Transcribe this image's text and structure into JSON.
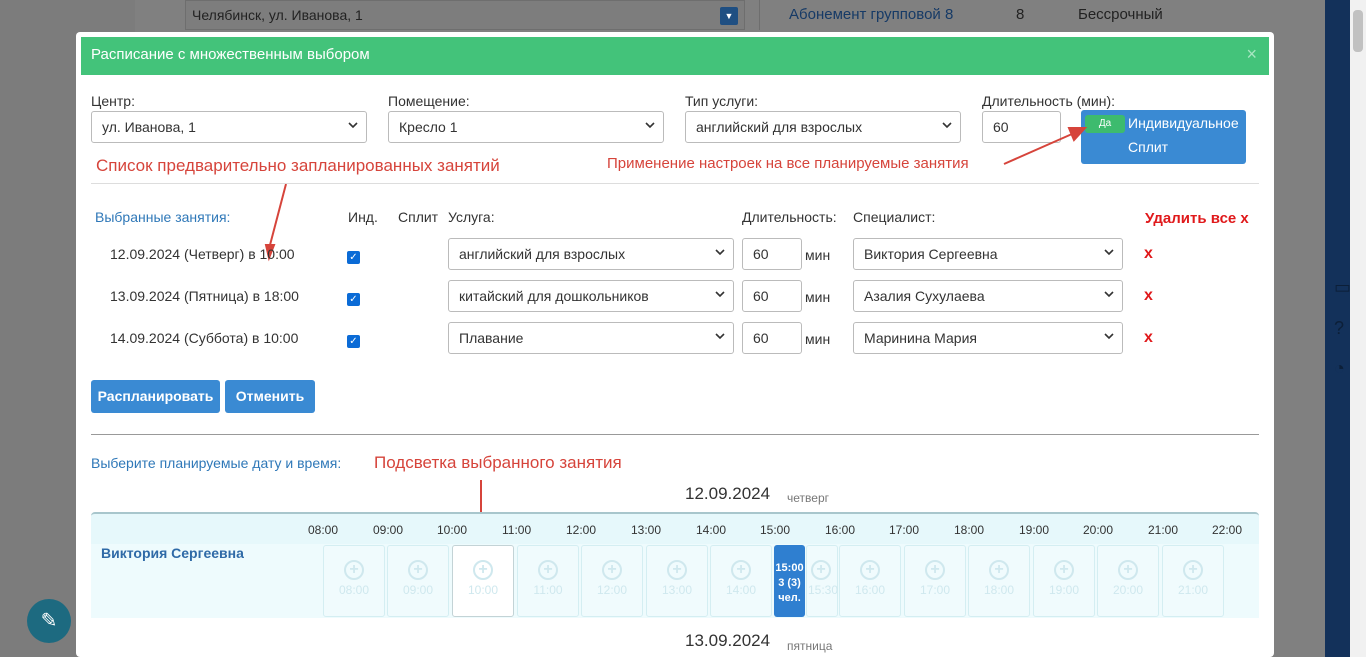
{
  "background": {
    "city_field": "Челябинск, ул. Иванова, 1",
    "subscription_link": "Абонемент групповой 8",
    "subscription_count": "8",
    "subscription_term": "Бессрочный"
  },
  "modal": {
    "title": "Расписание с множественным выбором",
    "close": "×"
  },
  "filters": {
    "center_label": "Центр:",
    "center_value": "ул. Иванова, 1",
    "room_label": "Помещение:",
    "room_value": "Кресло 1",
    "service_type_label": "Тип услуги:",
    "service_type_value": "английский для взрослых",
    "duration_label": "Длительность (мин):",
    "duration_value": "60",
    "toggle_label": "Да",
    "individual_label": "Индивидуальное",
    "split_label": "Сплит"
  },
  "annotations": {
    "planned_list": "Список предварительно запланированных занятий",
    "apply_settings": "Применение настроек на все планируемые занятия",
    "highlight": "Подсветка выбранного занятия"
  },
  "table": {
    "headers": {
      "selected": "Выбранные занятия:",
      "ind": "Инд.",
      "split": "Сплит",
      "service": "Услуга:",
      "duration": "Длительность:",
      "specialist": "Специалист:",
      "delete_all": "Удалить все x"
    },
    "min_label": "мин",
    "delete_mark": "x",
    "rows": [
      {
        "date": "12.09.2024 (Четверг) в 10:00",
        "service": "английский для взрослых",
        "duration": "60",
        "specialist": "Виктория Сергеевна"
      },
      {
        "date": "13.09.2024 (Пятница) в 18:00",
        "service": "китайский для дошкольников",
        "duration": "60",
        "specialist": "Азалия Сухулаева"
      },
      {
        "date": "14.09.2024 (Суббота) в 10:00",
        "service": "Плавание",
        "duration": "60",
        "specialist": "Маринина Мария"
      }
    ]
  },
  "buttons": {
    "schedule": "Распланировать",
    "cancel": "Отменить"
  },
  "timeline": {
    "pick_label": "Выберите планируемые дату и время:",
    "date1": "12.09.2024",
    "dow1": "четверг",
    "date2": "13.09.2024",
    "dow2": "пятница",
    "ticks": [
      "08:00",
      "09:00",
      "10:00",
      "11:00",
      "12:00",
      "13:00",
      "14:00",
      "15:00",
      "16:00",
      "17:00",
      "18:00",
      "19:00",
      "20:00",
      "21:00",
      "22:00"
    ],
    "specialist": "Виктория Сергеевна",
    "slots": [
      "08:00",
      "09:00",
      "10:00",
      "11:00",
      "12:00",
      "13:00",
      "14:00",
      "15:30",
      "16:00",
      "17:00",
      "18:00",
      "19:00",
      "20:00",
      "21:00"
    ],
    "booked_time": "15:00",
    "booked_count": "3 (3)",
    "booked_unit": "чел."
  }
}
